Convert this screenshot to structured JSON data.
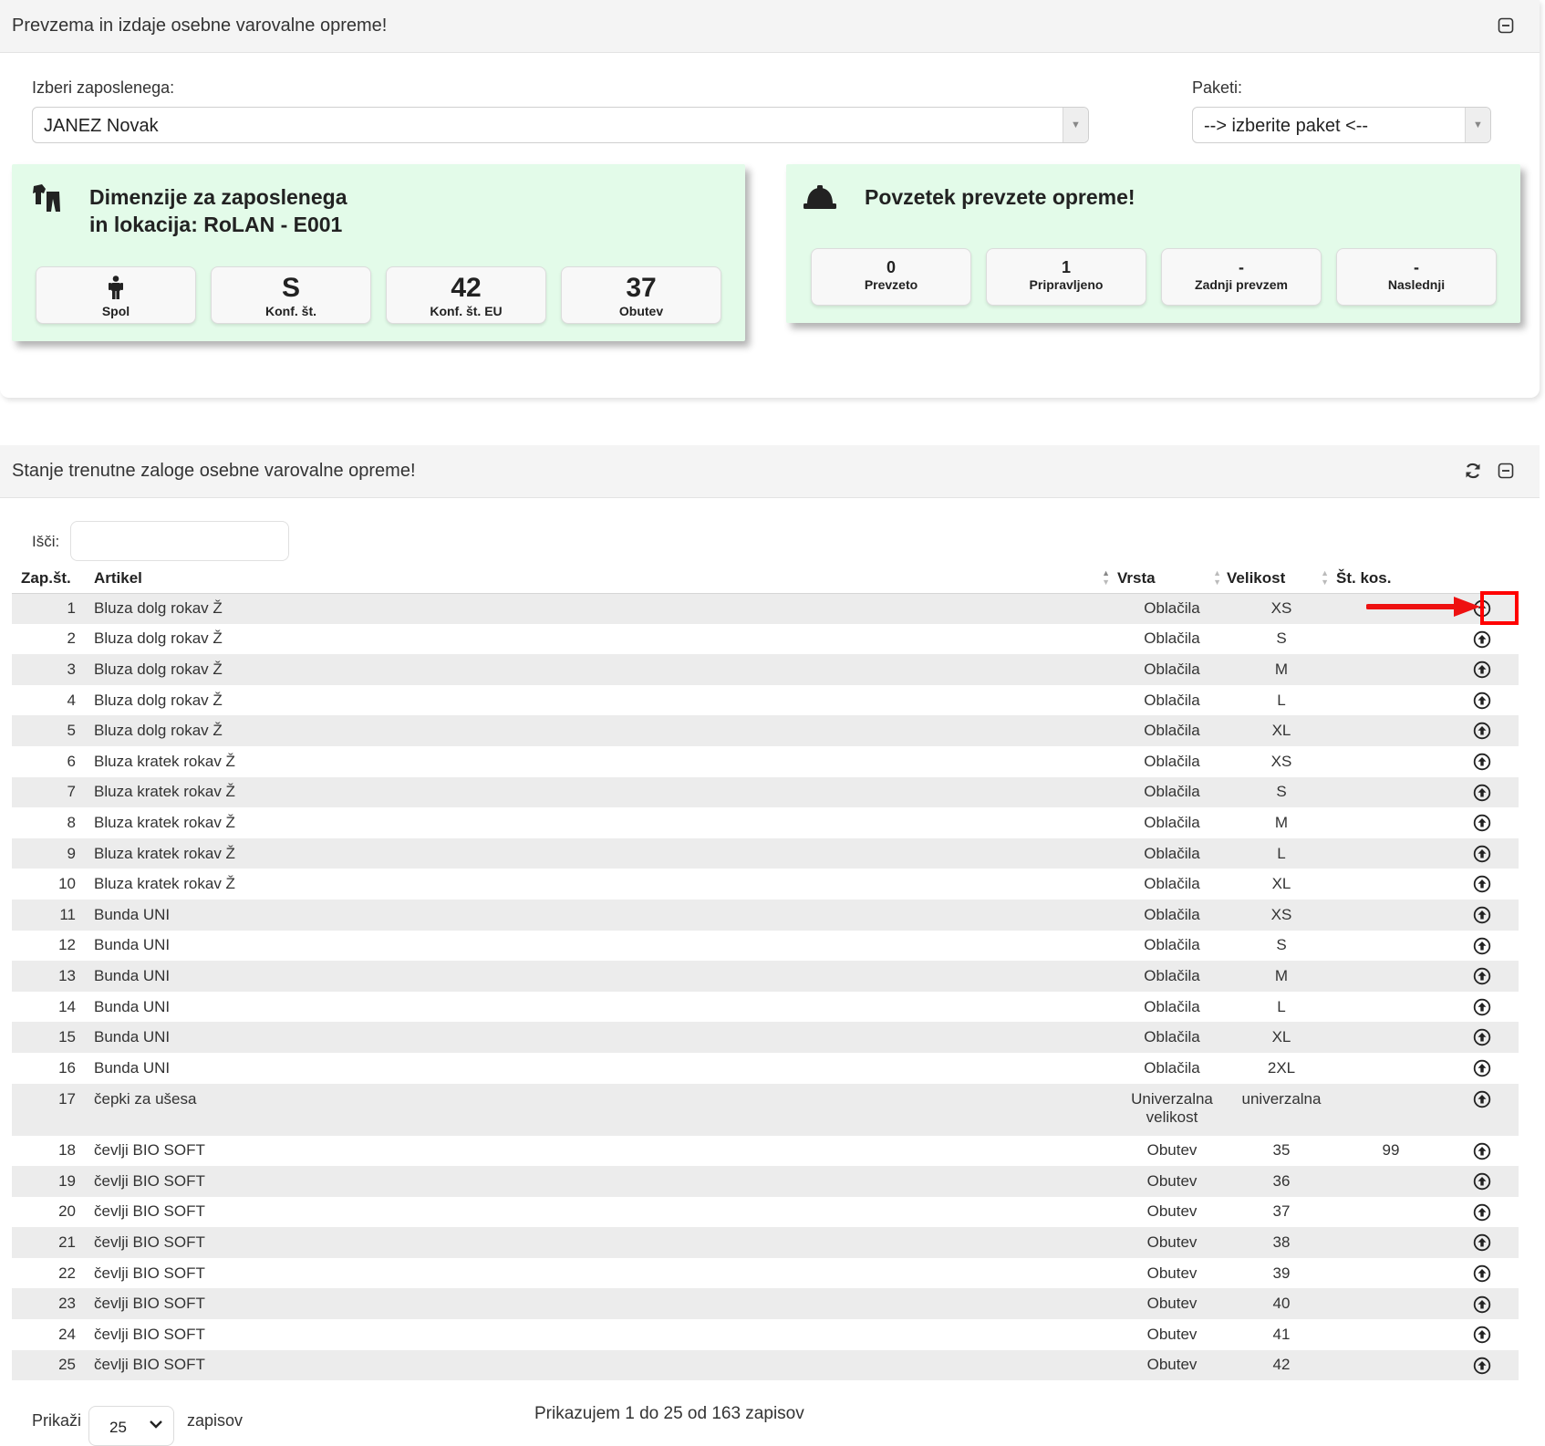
{
  "panel1": {
    "title": "Prevzema in izdaje osebne varovalne opreme!",
    "employee_label": "Izberi zaposlenega:",
    "employee_value": "JANEZ Novak",
    "packages_label": "Paketi:",
    "packages_value": "--> izberite paket <--"
  },
  "dimensions_card": {
    "title_line1": "Dimenzije za zaposlenega",
    "title_line2": "in lokacija: RoLAN - E001",
    "stats": [
      {
        "value": "",
        "label": "Spol"
      },
      {
        "value": "S",
        "label": "Konf. št."
      },
      {
        "value": "42",
        "label": "Konf. št. EU"
      },
      {
        "value": "37",
        "label": "Obutev"
      }
    ]
  },
  "summary_card": {
    "title": "Povzetek prevzete opreme!",
    "stats": [
      {
        "value": "0",
        "label": "Prevzeto"
      },
      {
        "value": "1",
        "label": "Pripravljeno"
      },
      {
        "value": "-",
        "label": "Zadnji prevzem"
      },
      {
        "value": "-",
        "label": "Naslednji"
      }
    ]
  },
  "panel2": {
    "title": "Stanje trenutne zaloge osebne varovalne opreme!",
    "search_label": "Išči:",
    "search_value": ""
  },
  "table": {
    "columns": [
      "Zap.št.",
      "Artikel",
      "Vrsta",
      "Velikost",
      "Št. kos."
    ],
    "rows": [
      [
        "1",
        "Bluza dolg rokav Ž",
        "Oblačila",
        "XS",
        ""
      ],
      [
        "2",
        "Bluza dolg rokav Ž",
        "Oblačila",
        "S",
        ""
      ],
      [
        "3",
        "Bluza dolg rokav Ž",
        "Oblačila",
        "M",
        ""
      ],
      [
        "4",
        "Bluza dolg rokav Ž",
        "Oblačila",
        "L",
        ""
      ],
      [
        "5",
        "Bluza dolg rokav Ž",
        "Oblačila",
        "XL",
        ""
      ],
      [
        "6",
        "Bluza kratek rokav Ž",
        "Oblačila",
        "XS",
        ""
      ],
      [
        "7",
        "Bluza kratek rokav Ž",
        "Oblačila",
        "S",
        ""
      ],
      [
        "8",
        "Bluza kratek rokav Ž",
        "Oblačila",
        "M",
        ""
      ],
      [
        "9",
        "Bluza kratek rokav Ž",
        "Oblačila",
        "L",
        ""
      ],
      [
        "10",
        "Bluza kratek rokav Ž",
        "Oblačila",
        "XL",
        ""
      ],
      [
        "11",
        "Bunda UNI",
        "Oblačila",
        "XS",
        ""
      ],
      [
        "12",
        "Bunda UNI",
        "Oblačila",
        "S",
        ""
      ],
      [
        "13",
        "Bunda UNI",
        "Oblačila",
        "M",
        ""
      ],
      [
        "14",
        "Bunda UNI",
        "Oblačila",
        "L",
        ""
      ],
      [
        "15",
        "Bunda UNI",
        "Oblačila",
        "XL",
        ""
      ],
      [
        "16",
        "Bunda UNI",
        "Oblačila",
        "2XL",
        ""
      ],
      [
        "17",
        "čepki za ušesa",
        "Univerzalna velikost",
        "univerzalna",
        ""
      ],
      [
        "18",
        "čevlji BIO SOFT",
        "Obutev",
        "35",
        "99"
      ],
      [
        "19",
        "čevlji BIO SOFT",
        "Obutev",
        "36",
        ""
      ],
      [
        "20",
        "čevlji BIO SOFT",
        "Obutev",
        "37",
        ""
      ],
      [
        "21",
        "čevlji BIO SOFT",
        "Obutev",
        "38",
        ""
      ],
      [
        "22",
        "čevlji BIO SOFT",
        "Obutev",
        "39",
        ""
      ],
      [
        "23",
        "čevlji BIO SOFT",
        "Obutev",
        "40",
        ""
      ],
      [
        "24",
        "čevlji BIO SOFT",
        "Obutev",
        "41",
        ""
      ],
      [
        "25",
        "čevlji BIO SOFT",
        "Obutev",
        "42",
        ""
      ]
    ]
  },
  "footer": {
    "show_label": "Prikaži",
    "page_length": "25",
    "records_label": "zapisov",
    "info": "Prikazujem 1 do 25 od 163 zapisov"
  },
  "colors": {
    "card_bg": "#e3fbe9",
    "highlight": "#ff0000",
    "row_stripe": "#ececec"
  },
  "icons": {
    "dimensions_card": "clothes-icon",
    "summary_card": "hard-hat-icon",
    "gender_stat": "person-icon",
    "row_action": "circle-arrow-up-icon",
    "header_collapse": "minus-square-icon",
    "header_refresh": "refresh-icon"
  }
}
